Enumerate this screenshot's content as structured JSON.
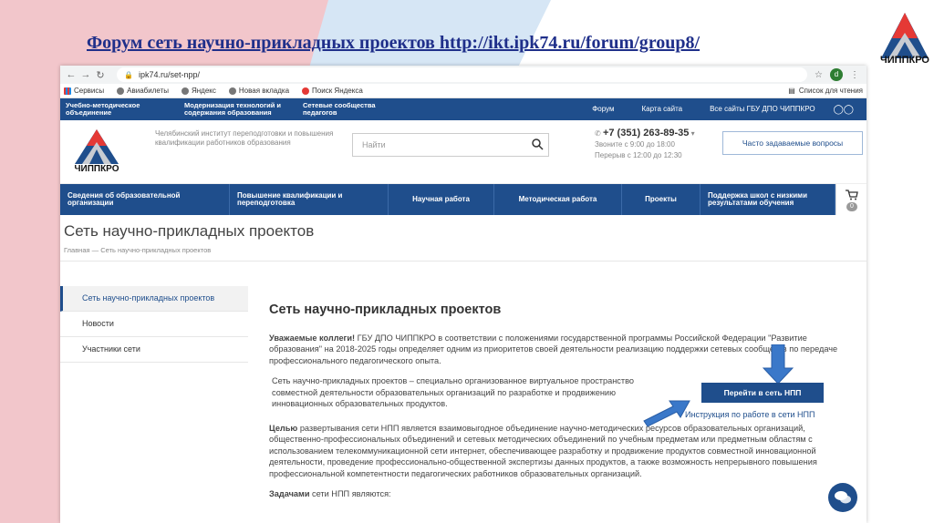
{
  "slide": {
    "title": "Форум сеть научно-прикладных проектов http://ikt.ipk74.ru/forum/group8/",
    "logo_text": "ЧИППКРО"
  },
  "browser": {
    "url": "ipk74.ru/set-npp/",
    "avatar_letter": "d",
    "bookmarks": [
      "Сервисы",
      "Авиабилеты",
      "Яндекс",
      "Новая вкладка",
      "Поиск Яндекса"
    ],
    "reading_list": "Список для чтения"
  },
  "site": {
    "topstrip": {
      "left": [
        "Учебно-методическое объединение",
        "Модернизация технологий и содержания образования",
        "Сетевые сообщества педагогов"
      ],
      "right": [
        "Форум",
        "Карта сайта",
        "Все сайты ГБУ ДПО ЧИППКРО"
      ]
    },
    "header": {
      "logo_text": "ЧИППКРО",
      "institute": "Челябинский институт переподготовки и повышения квалификации работников образования",
      "search_placeholder": "Найти",
      "phone": "+7 (351) 263-89-35",
      "hours": "Звоните с 9:00 до 18:00",
      "break": "Перерыв с 12:00 до 12:30",
      "faq": "Часто задаваемые вопросы"
    },
    "mainnav": [
      "Сведения об образовательной организации",
      "Повышение квалификации и переподготовка",
      "Научная работа",
      "Методическая работа",
      "Проекты",
      "Поддержка школ с низкими результатами обучения"
    ],
    "cart_count": "0",
    "page_title": "Сеть научно-прикладных проектов",
    "breadcrumb": [
      "Главная",
      "Сеть научно-прикладных проектов"
    ],
    "sidebar": [
      "Сеть научно-прикладных проектов",
      "Новости",
      "Участники сети"
    ],
    "content": {
      "title": "Сеть научно-прикладных проектов",
      "greeting_bold": "Уважаемые коллеги!",
      "greeting": " ГБУ ДПО ЧИППКРО в соответствии с положениями государственной программы Российской Федерации \"Развитие образования\" на 2018-2025 годы определяет одним из приоритетов своей деятельности реализацию поддержки сетевых сообществ по передаче профессионального педагогического опыта.",
      "definition": "Сеть научно-прикладных проектов – специально организованное виртуальное пространство совместной деятельности образовательных организаций по разработке и продвижению инновационных образовательных продуктов.",
      "goal_bold": "Целью",
      "goal": " развертывания сети НПП является взаимовыгодное объединение научно-методических ресурсов образовательных организаций, общественно-профессиональных объединений и сетевых методических объединений по учебным предметам или предметным областям с использованием телекоммуникационной сети интернет, обеспечивающее разработку и продвижение продуктов совместной инновационной деятельности, проведение профессионально-общественной экспертизы данных продуктов, а также возможность непрерывного повышения профессиональной компетентности педагогических работников образовательных организаций.",
      "tasks_bold": "Задачами",
      "tasks": " сети НПП являются:",
      "go_button": "Перейти в сеть НПП",
      "instruction_link": "Инструкция по работе в сети НПП"
    }
  },
  "colors": {
    "brand": "#1f4e8c",
    "arrow": "#3a78c9",
    "title": "#1f2f8a"
  }
}
